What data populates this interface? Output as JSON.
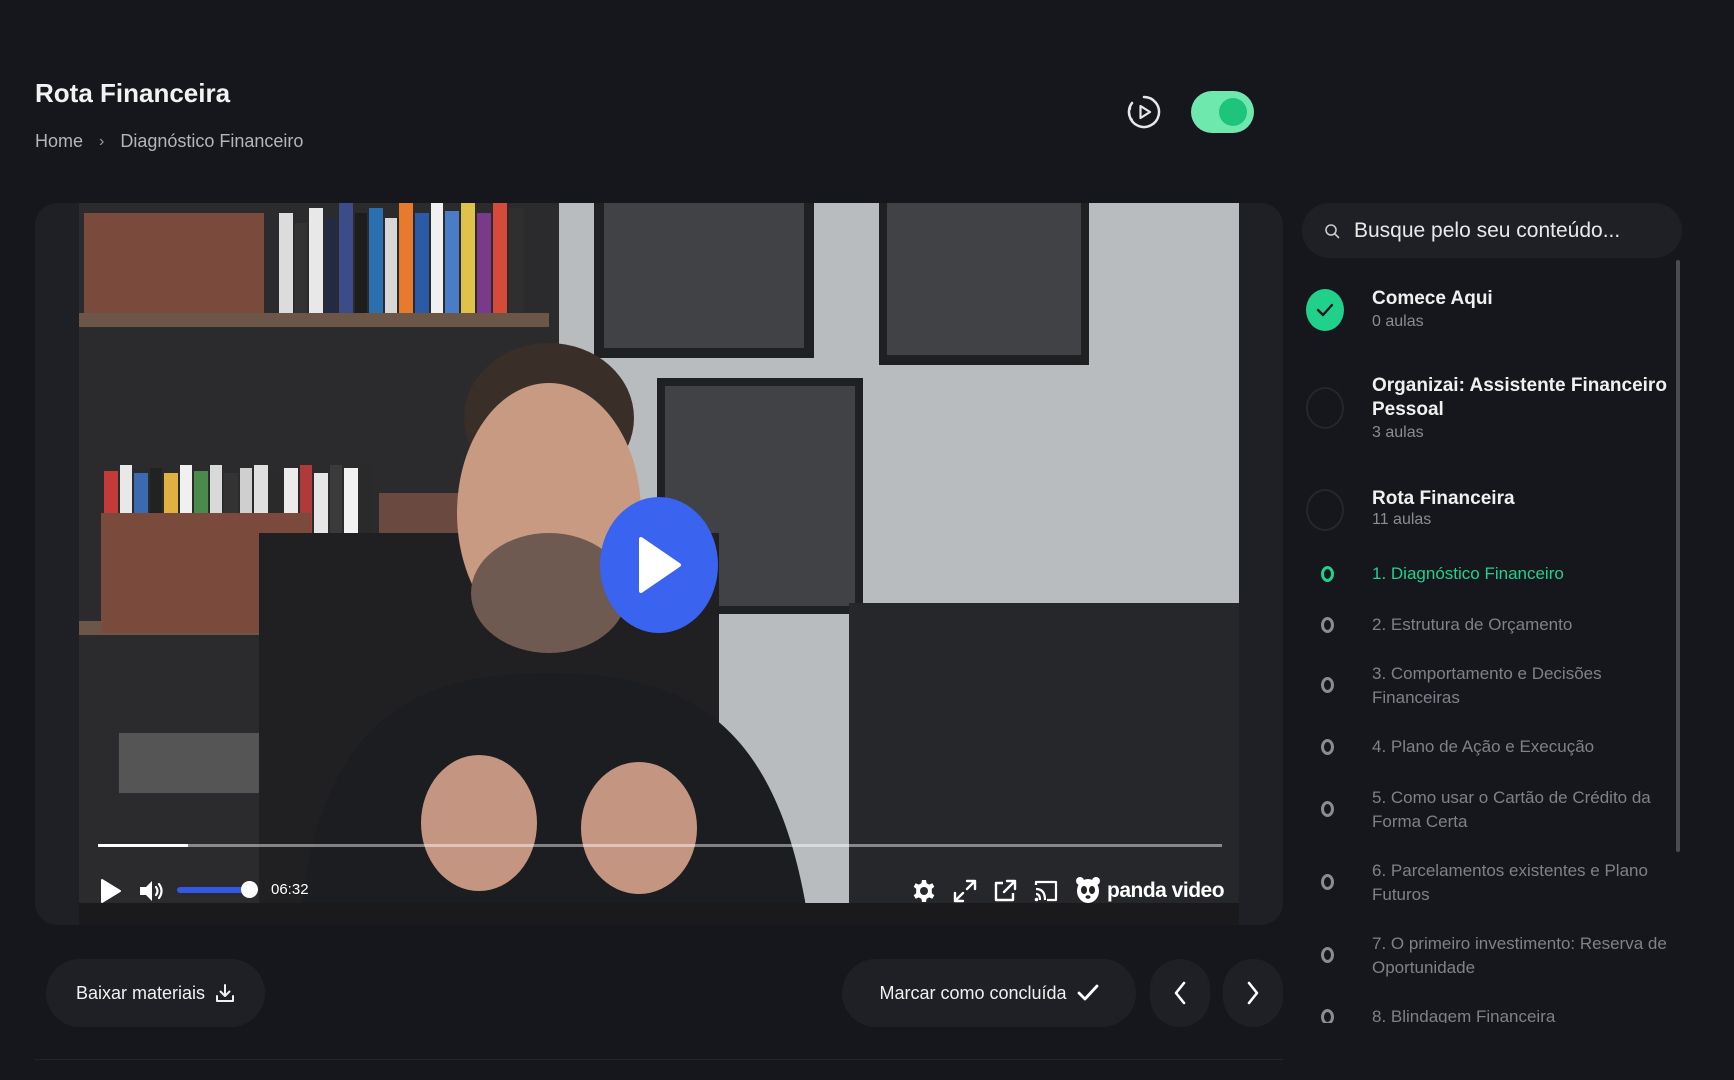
{
  "header": {
    "title": "Rota Financeira",
    "breadcrumb": {
      "home": "Home",
      "separator": "›",
      "current": "Diagnóstico Financeiro"
    },
    "autoplay_icon": "play-circle-dashed-icon",
    "autoplay_enabled": true
  },
  "player": {
    "time": "06:32",
    "brand": "panda video",
    "progress_fraction": 0.08,
    "volume_fraction": 0.9,
    "accent_color": "#3a63f0",
    "icons": [
      "play-icon",
      "volume-icon",
      "settings-icon",
      "fullscreen-icon",
      "popout-icon",
      "cast-icon",
      "panda-logo-icon",
      "big-play-icon"
    ]
  },
  "actions": {
    "download_label": "Baixar materiais",
    "complete_label": "Marcar como concluída",
    "prev_icon": "chevron-left-icon",
    "next_icon": "chevron-right-icon"
  },
  "sidebar": {
    "search_placeholder": "Busque pelo seu conteúdo...",
    "modules": [
      {
        "title": "Comece Aqui",
        "subtitle": "0 aulas",
        "completed": true
      },
      {
        "title": "Organizai: Assistente Financeiro Pessoal",
        "subtitle": "3 aulas",
        "completed": false
      },
      {
        "title": "Rota Financeira",
        "subtitle": "11 aulas",
        "completed": false
      }
    ],
    "lessons": [
      {
        "title": "1. Diagnóstico Financeiro",
        "active": true
      },
      {
        "title": "2. Estrutura de Orçamento",
        "active": false
      },
      {
        "title": "3. Comportamento e Decisões Financeiras",
        "active": false
      },
      {
        "title": "4. Plano de Ação e Execução",
        "active": false
      },
      {
        "title": "5. Como usar o Cartão de Crédito da Forma Certa",
        "active": false
      },
      {
        "title": "6. Parcelamentos existentes e Plano Futuros",
        "active": false
      },
      {
        "title": "7. O primeiro investimento: Reserva de Oportunidade",
        "active": false
      },
      {
        "title": "8. Blindagem Financeira",
        "active": false
      }
    ]
  },
  "colors": {
    "background": "#16171c",
    "card": "#1f2026",
    "accent_green": "#21d08a",
    "toggle_track": "#6ee8ad"
  }
}
